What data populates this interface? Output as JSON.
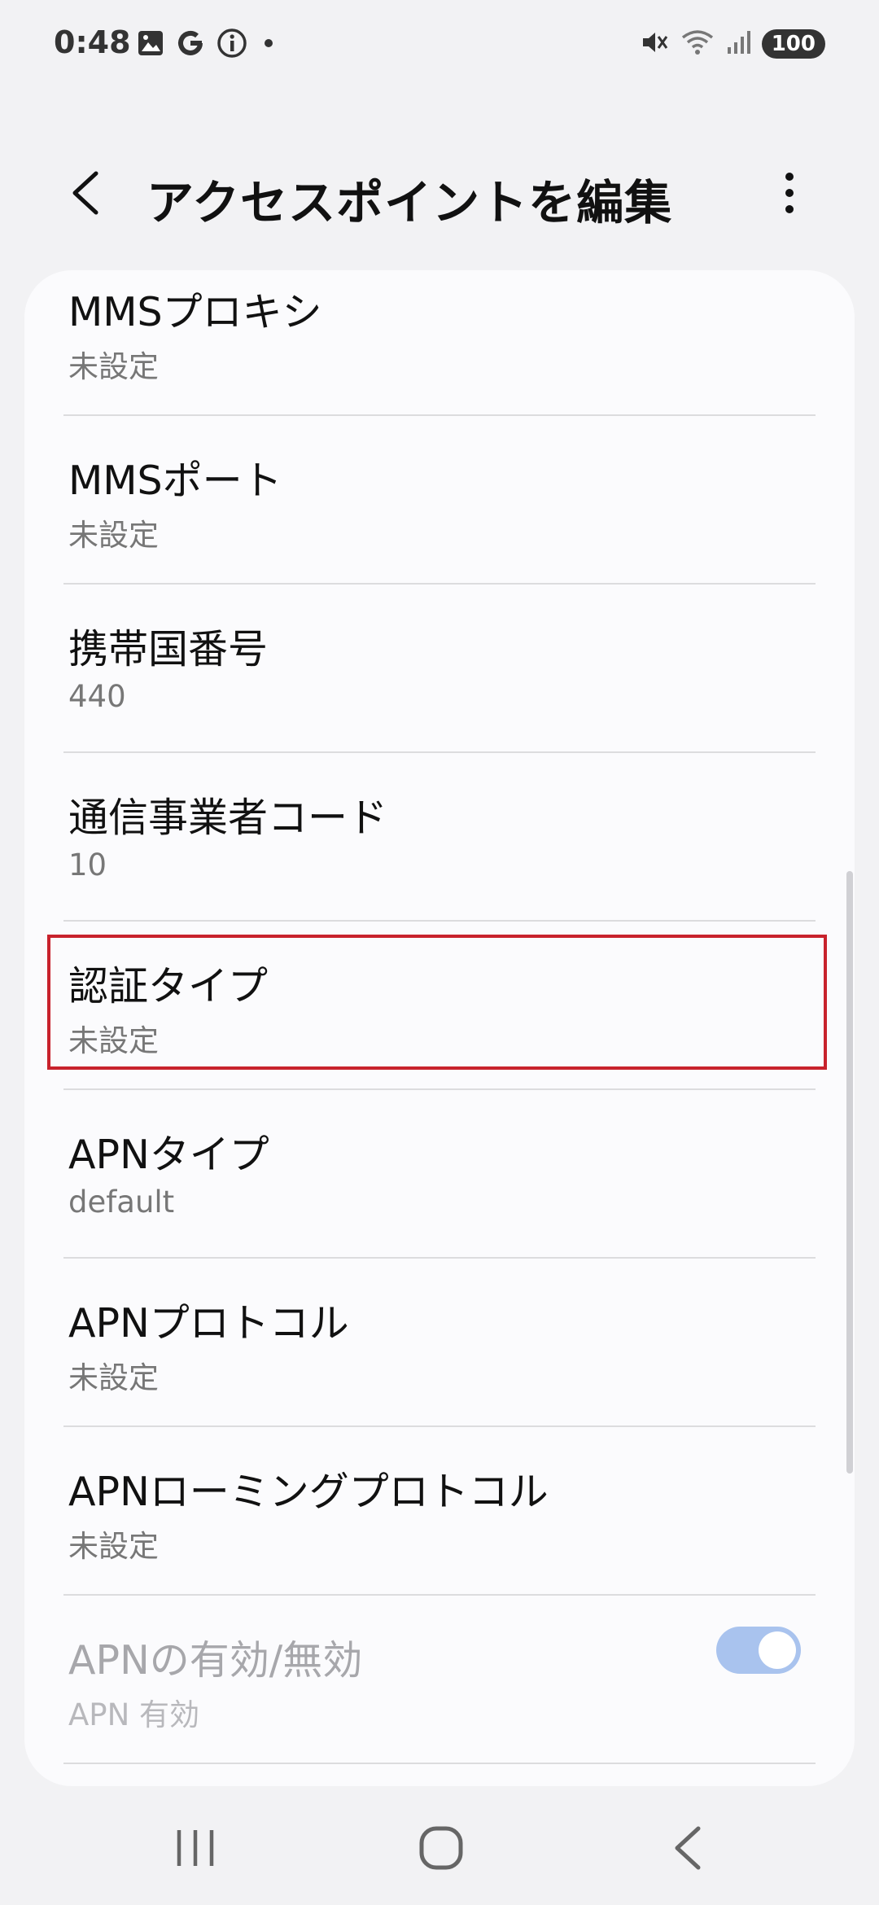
{
  "status_bar": {
    "time": "0:48",
    "left_icons": [
      "image-icon",
      "google-g-icon",
      "info-icon",
      "dot-icon"
    ],
    "right_icons": [
      "mute-icon",
      "wifi-icon",
      "signal-icon"
    ],
    "battery": "100"
  },
  "app_bar": {
    "title": "アクセスポイントを編集"
  },
  "settings": [
    {
      "title": "MMSプロキシ",
      "value": "未設定"
    },
    {
      "title": "MMSポート",
      "value": "未設定"
    },
    {
      "title": "携帯国番号",
      "value": "440"
    },
    {
      "title": "通信事業者コード",
      "value": "10"
    },
    {
      "title": "認証タイプ",
      "value": "未設定",
      "highlighted": true
    },
    {
      "title": "APNタイプ",
      "value": "default"
    },
    {
      "title": "APNプロトコル",
      "value": "未設定"
    },
    {
      "title": "APNローミングプロトコル",
      "value": "未設定"
    },
    {
      "title": "APNの有効/無効",
      "value": "APN 有効",
      "disabled": true,
      "toggle_on": true
    }
  ],
  "colors": {
    "highlight": "#c8222c",
    "toggle_on": "#a9c3ee"
  }
}
